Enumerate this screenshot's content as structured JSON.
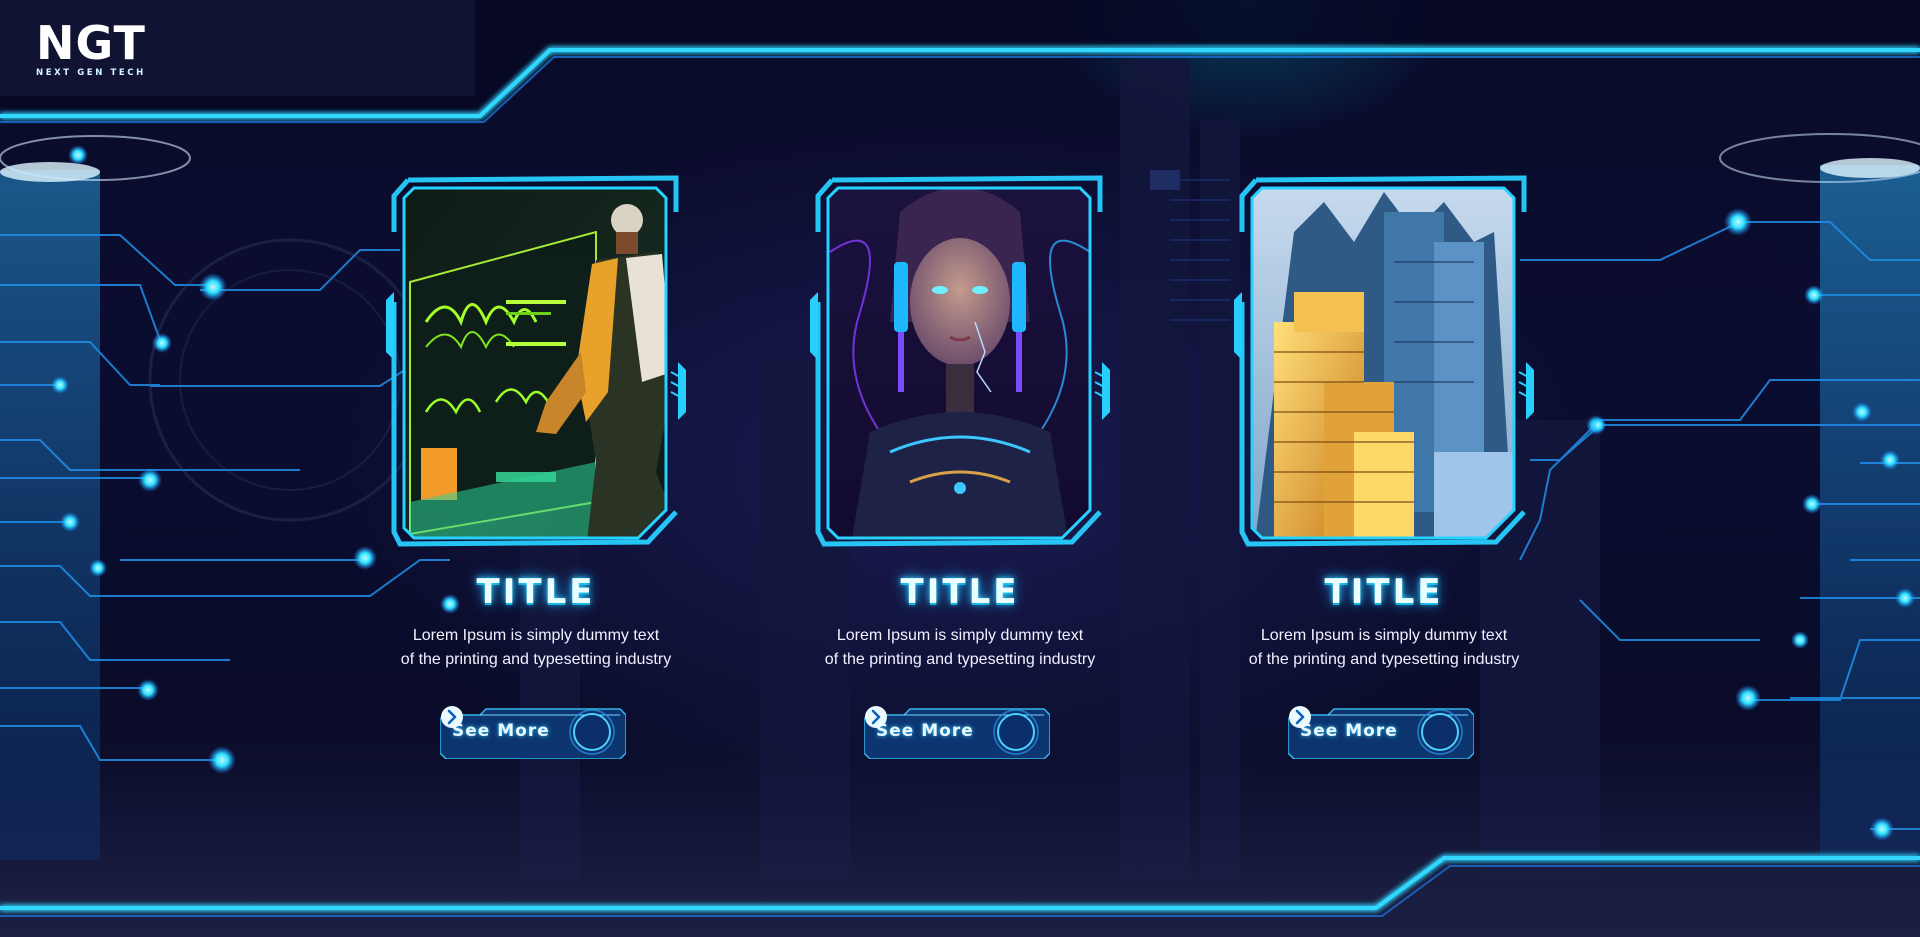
{
  "brand": {
    "logo_mark": "NGT",
    "logo_subtitle": "NEXT GEN TECH"
  },
  "colors": {
    "accent": "#1ec8ff",
    "glow": "#35e0ff",
    "background": "#0a0b2a"
  },
  "cards": [
    {
      "title": "TITLE",
      "desc_line1": "Lorem Ipsum is simply dummy text",
      "desc_line2": "of the printing and typesetting industry",
      "button_label": "See More",
      "button_icon": "chevron-right-icon",
      "image": "cyber-hacker-at-holographic-screen"
    },
    {
      "title": "TITLE",
      "desc_line1": "Lorem Ipsum is simply dummy text",
      "desc_line2": "of the printing and typesetting industry",
      "button_label": "See More",
      "button_icon": "chevron-right-icon",
      "image": "cyborg-girl-portrait"
    },
    {
      "title": "TITLE",
      "desc_line1": "Lorem Ipsum is simply dummy text",
      "desc_line2": "of the printing and typesetting industry",
      "button_label": "See More",
      "button_icon": "chevron-right-icon",
      "image": "futuristic-golden-city"
    }
  ]
}
